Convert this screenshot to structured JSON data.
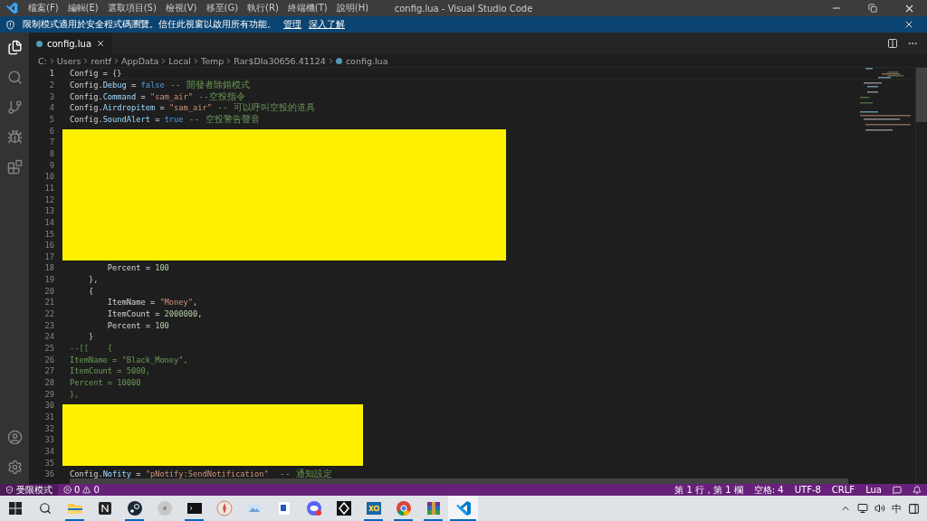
{
  "window": {
    "title": "config.lua - Visual Studio Code"
  },
  "menu": [
    "檔案(F)",
    "編輯(E)",
    "選取項目(S)",
    "檢視(V)",
    "移至(G)",
    "執行(R)",
    "終端機(T)",
    "說明(H)"
  ],
  "banner": {
    "message": "限制模式適用於安全程式碼瀏覽。信任此視窗以啟用所有功能。",
    "links": [
      "管理",
      "深入了解"
    ]
  },
  "tabs": [
    {
      "label": "config.lua",
      "selected": true
    }
  ],
  "breadcrumb": [
    "C:",
    "Users",
    "rentf",
    "AppData",
    "Local",
    "Temp",
    "Rar$DIa30656.41124",
    "config.lua"
  ],
  "editor": {
    "lines": [
      {
        "number": "1",
        "current": true,
        "tokens": [
          {
            "kind": "plain",
            "text": "Config = {}"
          }
        ]
      },
      {
        "number": "2",
        "current": false,
        "tokens": [
          {
            "kind": "plain",
            "text": "Config."
          },
          {
            "kind": "prop",
            "text": "Debug"
          },
          {
            "kind": "plain",
            "text": " = "
          },
          {
            "kind": "keyword",
            "text": "false"
          },
          {
            "kind": "note",
            "text": " -- 開發者除錯模式"
          }
        ]
      },
      {
        "number": "3",
        "current": false,
        "tokens": [
          {
            "kind": "plain",
            "text": "Config."
          },
          {
            "kind": "prop",
            "text": "Command"
          },
          {
            "kind": "plain",
            "text": " = "
          },
          {
            "kind": "string",
            "text": "\"sam_air\""
          },
          {
            "kind": "note",
            "text": " --空投指令"
          }
        ]
      },
      {
        "number": "4",
        "current": false,
        "tokens": [
          {
            "kind": "plain",
            "text": "Config."
          },
          {
            "kind": "prop",
            "text": "Airdropitem"
          },
          {
            "kind": "plain",
            "text": " = "
          },
          {
            "kind": "string",
            "text": "\"sam_air\""
          },
          {
            "kind": "note",
            "text": " -- 可以呼叫空投的道具"
          }
        ]
      },
      {
        "number": "5",
        "current": false,
        "tokens": [
          {
            "kind": "plain",
            "text": "Config."
          },
          {
            "kind": "prop",
            "text": "SoundAlert"
          },
          {
            "kind": "plain",
            "text": " = "
          },
          {
            "kind": "keyword",
            "text": "true"
          },
          {
            "kind": "note",
            "text": " -- 空投警告聲音"
          }
        ]
      },
      {
        "number": "6",
        "current": false
      },
      {
        "number": "7",
        "current": false
      },
      {
        "number": "8",
        "current": false
      },
      {
        "number": "9",
        "current": false
      },
      {
        "number": "10",
        "current": false
      },
      {
        "number": "11",
        "current": false
      },
      {
        "number": "12",
        "current": false
      },
      {
        "number": "13",
        "current": false
      },
      {
        "number": "14",
        "current": false
      },
      {
        "number": "15",
        "current": false
      },
      {
        "number": "16",
        "current": false
      },
      {
        "number": "17",
        "current": false
      },
      {
        "number": "18",
        "current": false,
        "tokens": [
          {
            "kind": "plain",
            "text": "        Percent = "
          },
          {
            "kind": "number",
            "text": "100"
          }
        ]
      },
      {
        "number": "19",
        "current": false,
        "tokens": [
          {
            "kind": "plain",
            "text": "    },"
          }
        ]
      },
      {
        "number": "20",
        "current": false,
        "tokens": [
          {
            "kind": "plain",
            "text": "    {"
          }
        ]
      },
      {
        "number": "21",
        "current": false,
        "tokens": [
          {
            "kind": "plain",
            "text": "        ItemName = "
          },
          {
            "kind": "string",
            "text": "\"Money\""
          },
          {
            "kind": "plain",
            "text": ","
          }
        ]
      },
      {
        "number": "22",
        "current": false,
        "tokens": [
          {
            "kind": "plain",
            "text": "        ItemCount = "
          },
          {
            "kind": "number",
            "text": "2000000"
          },
          {
            "kind": "plain",
            "text": ","
          }
        ]
      },
      {
        "number": "23",
        "current": false,
        "tokens": [
          {
            "kind": "plain",
            "text": "        Percent = "
          },
          {
            "kind": "number",
            "text": "100"
          }
        ]
      },
      {
        "number": "24",
        "current": false,
        "tokens": [
          {
            "kind": "plain",
            "text": "    }"
          }
        ]
      },
      {
        "number": "25",
        "current": false,
        "tokens": [
          {
            "kind": "comment",
            "text": "--[[    {"
          }
        ]
      },
      {
        "number": "26",
        "current": false,
        "tokens": [
          {
            "kind": "comment",
            "text": "ItemName = \"Black_Money\","
          }
        ]
      },
      {
        "number": "27",
        "current": false,
        "tokens": [
          {
            "kind": "comment",
            "text": "ItemCount = 5000,"
          }
        ]
      },
      {
        "number": "28",
        "current": false,
        "tokens": [
          {
            "kind": "comment",
            "text": "Percent = 10000"
          }
        ]
      },
      {
        "number": "29",
        "current": false,
        "tokens": [
          {
            "kind": "comment",
            "text": "},"
          }
        ]
      },
      {
        "number": "30",
        "current": false
      },
      {
        "number": "31",
        "current": false
      },
      {
        "number": "32",
        "current": false
      },
      {
        "number": "33",
        "current": false
      },
      {
        "number": "34",
        "current": false
      },
      {
        "number": "35",
        "current": false
      },
      {
        "number": "36",
        "current": false,
        "tokens": [
          {
            "kind": "plain",
            "text": "Config."
          },
          {
            "kind": "prop",
            "text": "Nofity"
          },
          {
            "kind": "plain",
            "text": " = "
          },
          {
            "kind": "string",
            "text": "\"pNotify:SendNotification\""
          },
          {
            "kind": "note",
            "text": "  -- 通知設定"
          }
        ]
      }
    ]
  },
  "status_bar": {
    "mode": "受限模式",
    "errors": "0",
    "warnings": "0",
    "items": [
      "第 1 行，第 1 欄",
      "空格: 4",
      "UTF-8",
      "CRLF",
      "Lua"
    ]
  },
  "taskbar": {
    "apps": [
      {
        "kind": "folder",
        "running": true,
        "selected": false
      },
      {
        "kind": "notes",
        "running": false,
        "selected": false
      },
      {
        "kind": "steam",
        "running": true,
        "selected": false
      },
      {
        "kind": "disc",
        "running": false,
        "selected": false
      },
      {
        "kind": "terminal",
        "running": true,
        "selected": false
      },
      {
        "kind": "compass",
        "running": false,
        "selected": false
      },
      {
        "kind": "photos",
        "running": false,
        "selected": false
      },
      {
        "kind": "document",
        "running": false,
        "selected": false
      },
      {
        "kind": "chat",
        "running": false,
        "selected": false
      },
      {
        "kind": "game",
        "running": false,
        "selected": false
      },
      {
        "kind": "xq",
        "running": true,
        "selected": false
      },
      {
        "kind": "browser",
        "running": true,
        "selected": false
      },
      {
        "kind": "archive",
        "running": true,
        "selected": false
      },
      {
        "kind": "code",
        "running": true,
        "selected": true
      }
    ],
    "input_method": "中"
  }
}
